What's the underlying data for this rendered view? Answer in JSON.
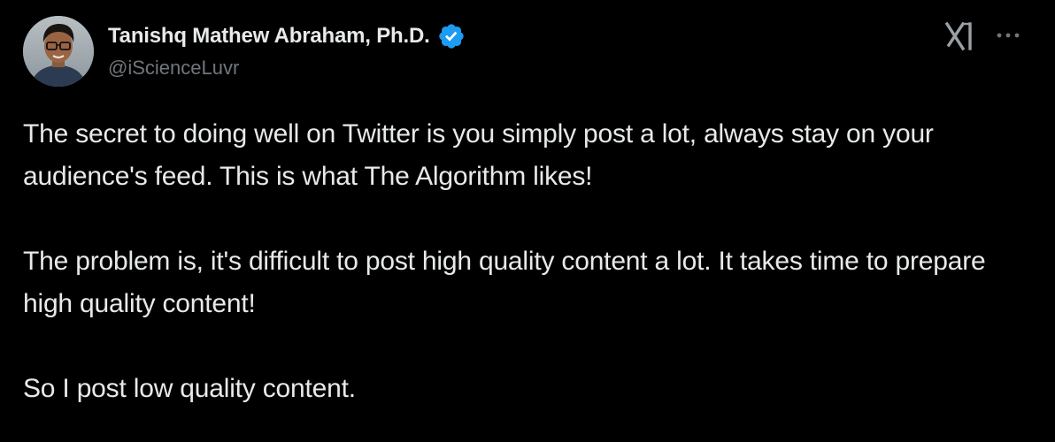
{
  "author": {
    "display_name": "Tanishq Mathew Abraham, Ph.D.",
    "handle": "@iScienceLuvr",
    "verified": true,
    "avatar_icon": "profile-photo"
  },
  "actions": {
    "grok_icon": "grok-icon",
    "more_icon": "more-options-icon"
  },
  "tweet": {
    "paragraphs": [
      "The secret to doing well on Twitter is you simply post a lot, always stay on your audience's feed. This is what The Algorithm likes!",
      "The problem is, it's difficult to post high quality content a lot. It takes time to prepare high quality content!",
      "So I post low quality content."
    ]
  },
  "colors": {
    "background": "#000000",
    "text": "#e7e9ea",
    "secondary_text": "#71767b",
    "verified_badge": "#1d9bf0"
  }
}
